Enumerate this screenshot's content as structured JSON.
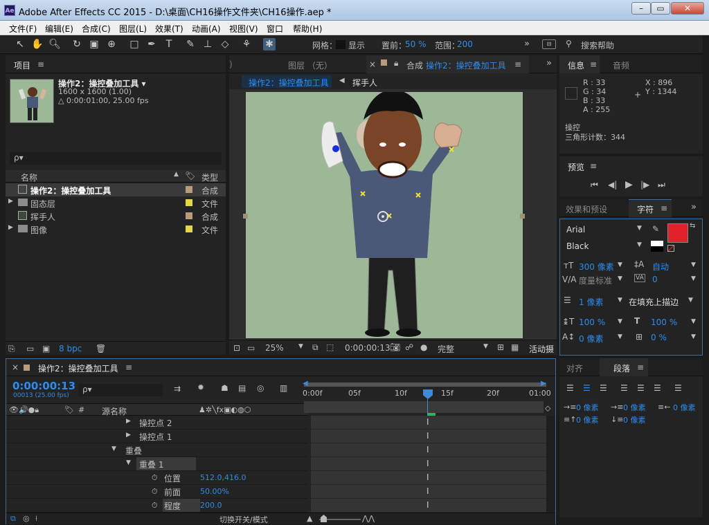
{
  "window": {
    "title": "Adobe After Effects CC 2015 - D:\\桌面\\CH16操作文件夹\\CH16操作.aep *",
    "app_icon": "Ae"
  },
  "menu": [
    "文件(F)",
    "编辑(E)",
    "合成(C)",
    "图层(L)",
    "效果(T)",
    "动画(A)",
    "视图(V)",
    "窗口",
    "帮助(H)"
  ],
  "toolbar": {
    "grid_label": "网格：",
    "show_label": "显示",
    "displace_label": "置前：",
    "displace_value": "50 %",
    "range_label": "范围：",
    "range_value": "200",
    "search_help": "搜索帮助"
  },
  "project": {
    "tab": "项目",
    "comp_name": "操作2：操控叠加工具 ▾",
    "comp_dims": "1600 x 1600 (1.00)",
    "comp_duration": "△ 0:00:01:00, 25.00 fps",
    "search_placeholder": "ρ▾",
    "col_name": "名称",
    "col_type": "类型",
    "items": [
      {
        "name": "操作2：操控叠加工具",
        "type": "合成",
        "color": "#b79b7a"
      },
      {
        "name": "固态层",
        "type": "文件",
        "color": "#e5d64a"
      },
      {
        "name": "挥手人",
        "type": "合成",
        "color": "#b79b7a"
      },
      {
        "name": "图像",
        "type": "文件",
        "color": "#e5d64a"
      }
    ],
    "bpc": "8 bpc"
  },
  "comp_panel": {
    "tab_left": ")",
    "tab_layer": "图层 （无）",
    "tab_comp_prefix": "合成",
    "tab_comp_name": "操作2：操控叠加工具",
    "crumb_active": "操作2：操控叠加工具",
    "crumb_next": "挥手人",
    "zoom": "25%",
    "timecode": "0:00:00:13",
    "quality": "完整",
    "active_camera": "活动摄"
  },
  "info": {
    "tab_info": "信息",
    "tab_audio": "音频",
    "r": "R : 33",
    "g": "G : 34",
    "b": "B : 33",
    "a": "A : 255",
    "x": "X : 896",
    "y": "Y : 1344",
    "tool_name": "操控",
    "triangle_count": "三角形计数：344"
  },
  "preview": {
    "tab": "预览"
  },
  "character": {
    "tab_effects": "效果和预设",
    "tab_char": "字符",
    "font": "Arial",
    "style": "Black",
    "size": "300 像素",
    "leading": "自动",
    "kerning": "度量标准",
    "tracking": "0",
    "stroke_width": "1 像素",
    "stroke_mode": "在填充上描边",
    "vscale": "100 %",
    "hscale": "100 %",
    "baseline": "0 像素",
    "tsume": "0 %",
    "fill_color": "#e1222a"
  },
  "paragraph": {
    "tab_align": "对齐",
    "tab_para": "段落",
    "indent_left": "0 像素",
    "indent_first": "0 像素",
    "indent_right": "0 像素",
    "space_before": "0 像素",
    "space_after": "0 像素"
  },
  "timeline": {
    "tab": "操作2：操控叠加工具",
    "timecode": "0:00:00:13",
    "frame_info": "00013 (25.00 fps)",
    "col_source": "源名称",
    "ruler": [
      "0:00f",
      "05f",
      "10f",
      "15f",
      "20f",
      "01:00"
    ],
    "layers": [
      {
        "indent": 1,
        "arrow": "▶",
        "label": "操控点 2"
      },
      {
        "indent": 1,
        "arrow": "▶",
        "label": "操控点 1"
      },
      {
        "indent": 0,
        "arrow": "▼",
        "label": "重叠"
      },
      {
        "indent": 1,
        "arrow": "▼",
        "label": "重叠 1"
      }
    ],
    "props": [
      {
        "label": "位置",
        "value": "512.0,416.0"
      },
      {
        "label": "前面",
        "value": "50.00%"
      },
      {
        "label": "程度",
        "value": "200.0"
      }
    ],
    "toggle_label": "切换开关/模式"
  }
}
